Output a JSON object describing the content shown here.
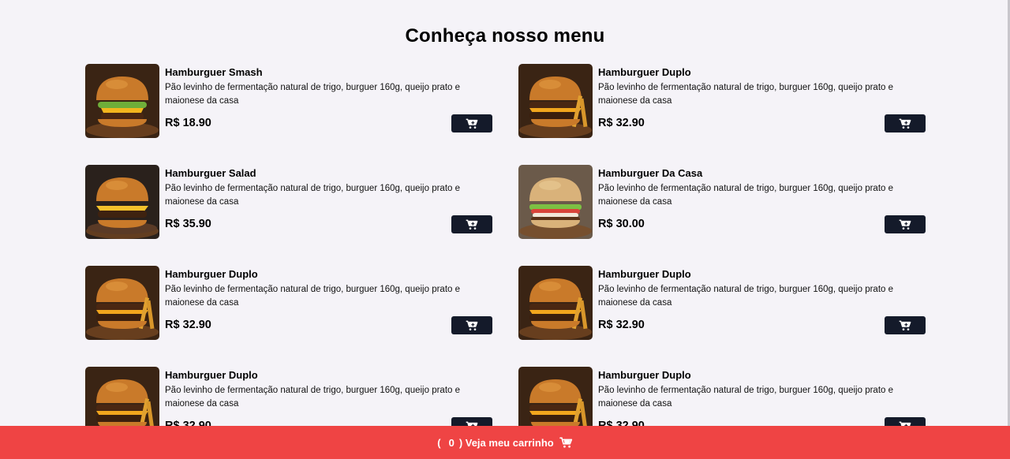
{
  "menu": {
    "title": "Conheça nosso menu",
    "items": [
      {
        "name": "Hamburguer Smash",
        "description": "Pão levinho de fermentação natural de trigo, burguer 160g, queijo prato e maionese da casa",
        "price": "R$ 18.90",
        "image": "burger-smash-image"
      },
      {
        "name": "Hamburguer Duplo",
        "description": "Pão levinho de fermentação natural de trigo, burguer 160g, queijo prato e maionese da casa",
        "price": "R$ 32.90",
        "image": "burger-duplo-image"
      },
      {
        "name": "Hamburguer Salad",
        "description": "Pão levinho de fermentação natural de trigo, burguer 160g, queijo prato e maionese da casa",
        "price": "R$ 35.90",
        "image": "burger-salad-image"
      },
      {
        "name": "Hamburguer Da Casa",
        "description": "Pão levinho de fermentação natural de trigo, burguer 160g, queijo prato e maionese da casa",
        "price": "R$ 30.00",
        "image": "burger-da-casa-image"
      },
      {
        "name": "Hamburguer Duplo",
        "description": "Pão levinho de fermentação natural de trigo, burguer 160g, queijo prato e maionese da casa",
        "price": "R$ 32.90",
        "image": "burger-duplo-image"
      },
      {
        "name": "Hamburguer Duplo",
        "description": "Pão levinho de fermentação natural de trigo, burguer 160g, queijo prato e maionese da casa",
        "price": "R$ 32.90",
        "image": "burger-duplo-image"
      },
      {
        "name": "Hamburguer Duplo",
        "description": "Pão levinho de fermentação natural de trigo, burguer 160g, queijo prato e maionese da casa",
        "price": "R$ 32.90",
        "image": "burger-duplo-image"
      },
      {
        "name": "Hamburguer Duplo",
        "description": "Pão levinho de fermentação natural de trigo, burguer 160g, queijo prato e maionese da casa",
        "price": "R$ 32.90",
        "image": "burger-duplo-image"
      }
    ],
    "add_to_cart_icon": "cart-plus-icon"
  },
  "footer": {
    "open_paren": "(",
    "count": "0",
    "label": ") Veja meu carrinho",
    "icon": "cart-icon"
  },
  "colors": {
    "background": "#f5f3f8",
    "button": "#141a2a",
    "footer": "#ef4444"
  }
}
